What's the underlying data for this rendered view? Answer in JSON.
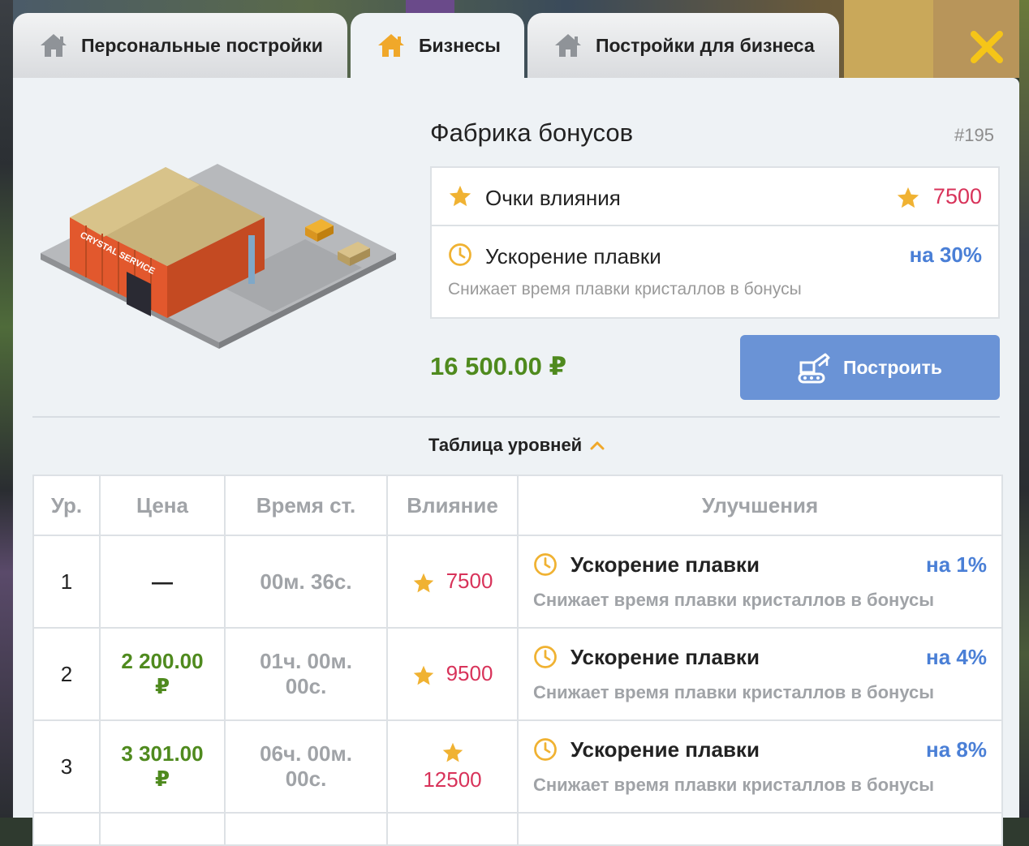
{
  "tabs": [
    {
      "label": "Персональные постройки",
      "icon": "house-icon",
      "active": false
    },
    {
      "label": "Бизнесы",
      "icon": "house-icon",
      "active": true
    },
    {
      "label": "Постройки для бизнеса",
      "icon": "house-icon",
      "active": false
    }
  ],
  "close_icon": "close-icon",
  "building": {
    "title": "Фабрика бонусов",
    "id": "#195",
    "sign_text": "CRYSTAL SERVICE",
    "influence": {
      "label": "Очки влияния",
      "value": "7500",
      "icon": "star-icon"
    },
    "boost": {
      "label": "Ускорение плавки",
      "value": "на 30%",
      "desc": "Снижает время плавки кристаллов в бонусы",
      "icon": "clock-icon"
    },
    "price": "16 500.00 ₽",
    "build_label": "Построить"
  },
  "levels_toggle": "Таблица уровней",
  "levels": {
    "headers": [
      "Ур.",
      "Цена",
      "Время ст.",
      "Влияние",
      "Улучшения"
    ],
    "rows": [
      {
        "level": "1",
        "price_line1": "—",
        "price_line2": "",
        "time_line1": "00м. 36с.",
        "time_line2": "",
        "influence": "7500",
        "upgrade": {
          "label": "Ускорение плавки",
          "value": "на 1%",
          "desc": "Снижает время плавки кристаллов в бонусы"
        }
      },
      {
        "level": "2",
        "price_line1": "2 200.00",
        "price_line2": "₽",
        "time_line1": "01ч. 00м.",
        "time_line2": "00с.",
        "influence": "9500",
        "upgrade": {
          "label": "Ускорение плавки",
          "value": "на 4%",
          "desc": "Снижает время плавки кристаллов в бонусы"
        }
      },
      {
        "level": "3",
        "price_line1": "3 301.00",
        "price_line2": "₽",
        "time_line1": "06ч. 00м.",
        "time_line2": "00с.",
        "influence": "12500",
        "upgrade": {
          "label": "Ускорение плавки",
          "value": "на 8%",
          "desc": "Снижает время плавки кристаллов в бонусы"
        }
      }
    ]
  },
  "colors": {
    "accent_blue": "#6a93d6",
    "price_green": "#4f8a1e",
    "influence_red": "#d8335a",
    "star_orange": "#f0b232"
  }
}
